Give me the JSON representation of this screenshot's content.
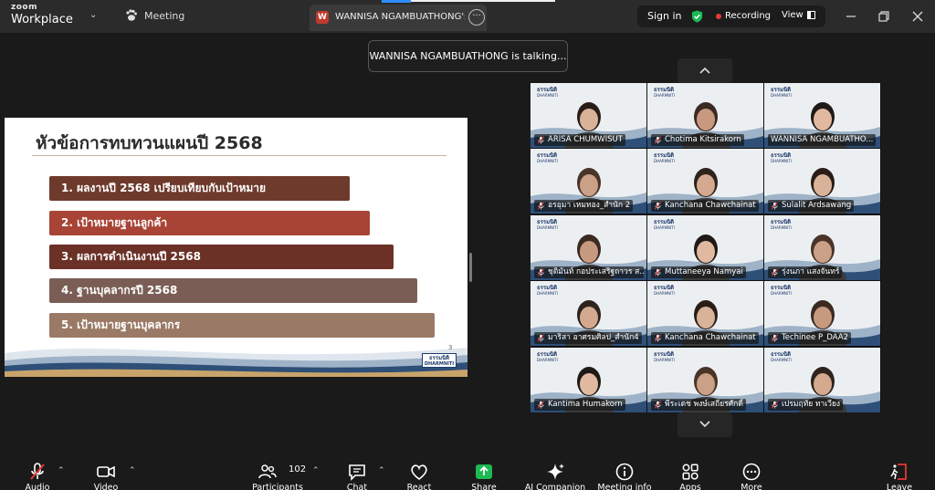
{
  "app": {
    "brand_small": "zoom",
    "brand_large": "Workplace"
  },
  "titlebar": {
    "meeting_label": "Meeting",
    "share_tab_title": "WANNISA NGAMBUATHONG's sc",
    "sign_in": "Sign in",
    "recording": "Recording",
    "view": "View"
  },
  "toast": {
    "text": "WANNISA NGAMBUATHONG is talking..."
  },
  "slide": {
    "title": "หัวข้อการทบทวนแผนปี 2568",
    "items": [
      "1.  ผลงานปี 2568 เปรียบเทียบกับเป้าหมาย",
      "2.  เป้าหมายฐานลูกค้า",
      "3.  ผลการดำเนินงานปี 2568",
      "4.  ฐานบุคลากรปี 2568",
      "5.  เป้าหมายฐานบุคลากร"
    ],
    "page_number": "3",
    "logo_th": "ธรรมนิติ",
    "logo_en": "DHARMNITI"
  },
  "gallery": {
    "participants": [
      {
        "name": "ARISA CHUMWISUT",
        "muted": true,
        "active": false
      },
      {
        "name": "Chotima Kitsirakorn",
        "muted": true,
        "active": false
      },
      {
        "name": "WANNISA NGAMBUATHO...",
        "muted": false,
        "active": true
      },
      {
        "name": "อรอุมา เหมทอง_สำนัก 2",
        "muted": true,
        "active": false
      },
      {
        "name": "Kanchana Chawchainat",
        "muted": true,
        "active": false
      },
      {
        "name": "Sulalit Ardsawang",
        "muted": true,
        "active": false
      },
      {
        "name": "ชุติมันท์ กอประเสริฐถาวร ส...",
        "muted": true,
        "active": false
      },
      {
        "name": "Muttaneeya Namyai",
        "muted": true,
        "active": false
      },
      {
        "name": "รุ่งนภา แสงจันทร์",
        "muted": true,
        "active": false
      },
      {
        "name": "มาริสา อาศรมศิลป_สำนัก4",
        "muted": true,
        "active": false
      },
      {
        "name": "Kanchana Chawchainat",
        "muted": true,
        "active": false
      },
      {
        "name": "Techinee P_DAA2",
        "muted": true,
        "active": false
      },
      {
        "name": "Kantima Humakorn",
        "muted": true,
        "active": false
      },
      {
        "name": "พีระเดช พงษ์เสถียรศักดิ์",
        "muted": true,
        "active": false
      },
      {
        "name": "เปรมฤทัย ทาเวียง",
        "muted": true,
        "active": false
      }
    ],
    "tile_logo_th": "ธรรมนิติ",
    "tile_logo_en": "DHARMNITI"
  },
  "toolbar": {
    "audio": "Audio",
    "video": "Video",
    "participants": "Participants",
    "participant_count": "102",
    "chat": "Chat",
    "react": "React",
    "share": "Share",
    "ai_companion": "AI Companion",
    "meeting_info": "Meeting info",
    "apps": "Apps",
    "more": "More",
    "leave": "Leave"
  },
  "colors": {
    "active_speaker": "#24d481",
    "share_green": "#1db954",
    "leave_red": "#e53935",
    "recording_red": "#e53935"
  }
}
